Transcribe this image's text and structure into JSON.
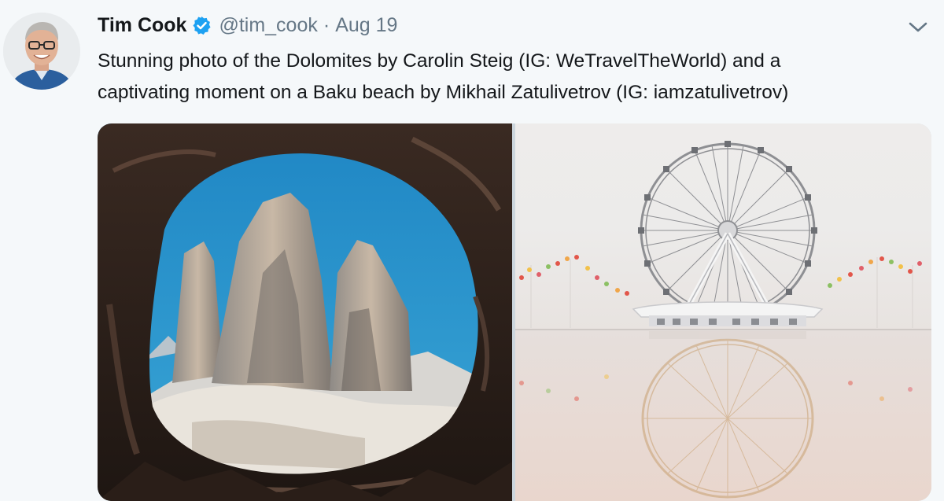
{
  "tweet": {
    "author_name": "Tim Cook",
    "handle": "@tim_cook",
    "separator": "·",
    "date": "Aug 19",
    "text_lines": [
      "Stunning photo of the Dolomites by Carolin Steig (IG: WeTravelTheWorld) and a",
      "captivating moment on a Baku beach by Mikhail Zatulivetrov (IG: iamzatulivetrov)"
    ],
    "verified": true
  },
  "icons": {
    "verified": "verified-badge-icon",
    "menu": "chevron-down-icon"
  },
  "colors": {
    "background": "#f5f8fa",
    "name_text": "#14171a",
    "secondary_text": "#657786",
    "verified_blue": "#1da1f2"
  }
}
